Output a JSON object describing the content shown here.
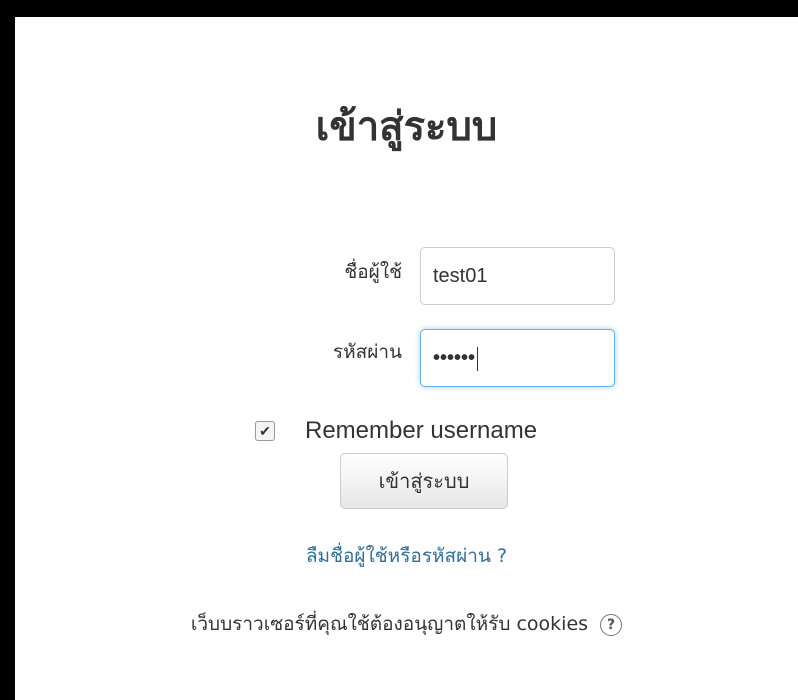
{
  "title": "เข้าสู่ระบบ",
  "username": {
    "label": "ชื่อผู้ใช้",
    "value": "test01"
  },
  "password": {
    "label": "รหัสผ่าน",
    "value": "••••••"
  },
  "remember": {
    "label": "Remember username",
    "checked": true
  },
  "login_button": "เข้าสู่ระบบ",
  "forgot_link": "ลืมชื่อผู้ใช้หรือรหัสผ่าน ?",
  "cookies_notice": "เว็บบราวเซอร์ที่คุณใช้ต้องอนุญาตให้รับ cookies",
  "icons": {
    "help": "help-icon",
    "check": "check-icon"
  },
  "colors": {
    "link": "#2f6f9a",
    "focus": "#66afe9"
  }
}
